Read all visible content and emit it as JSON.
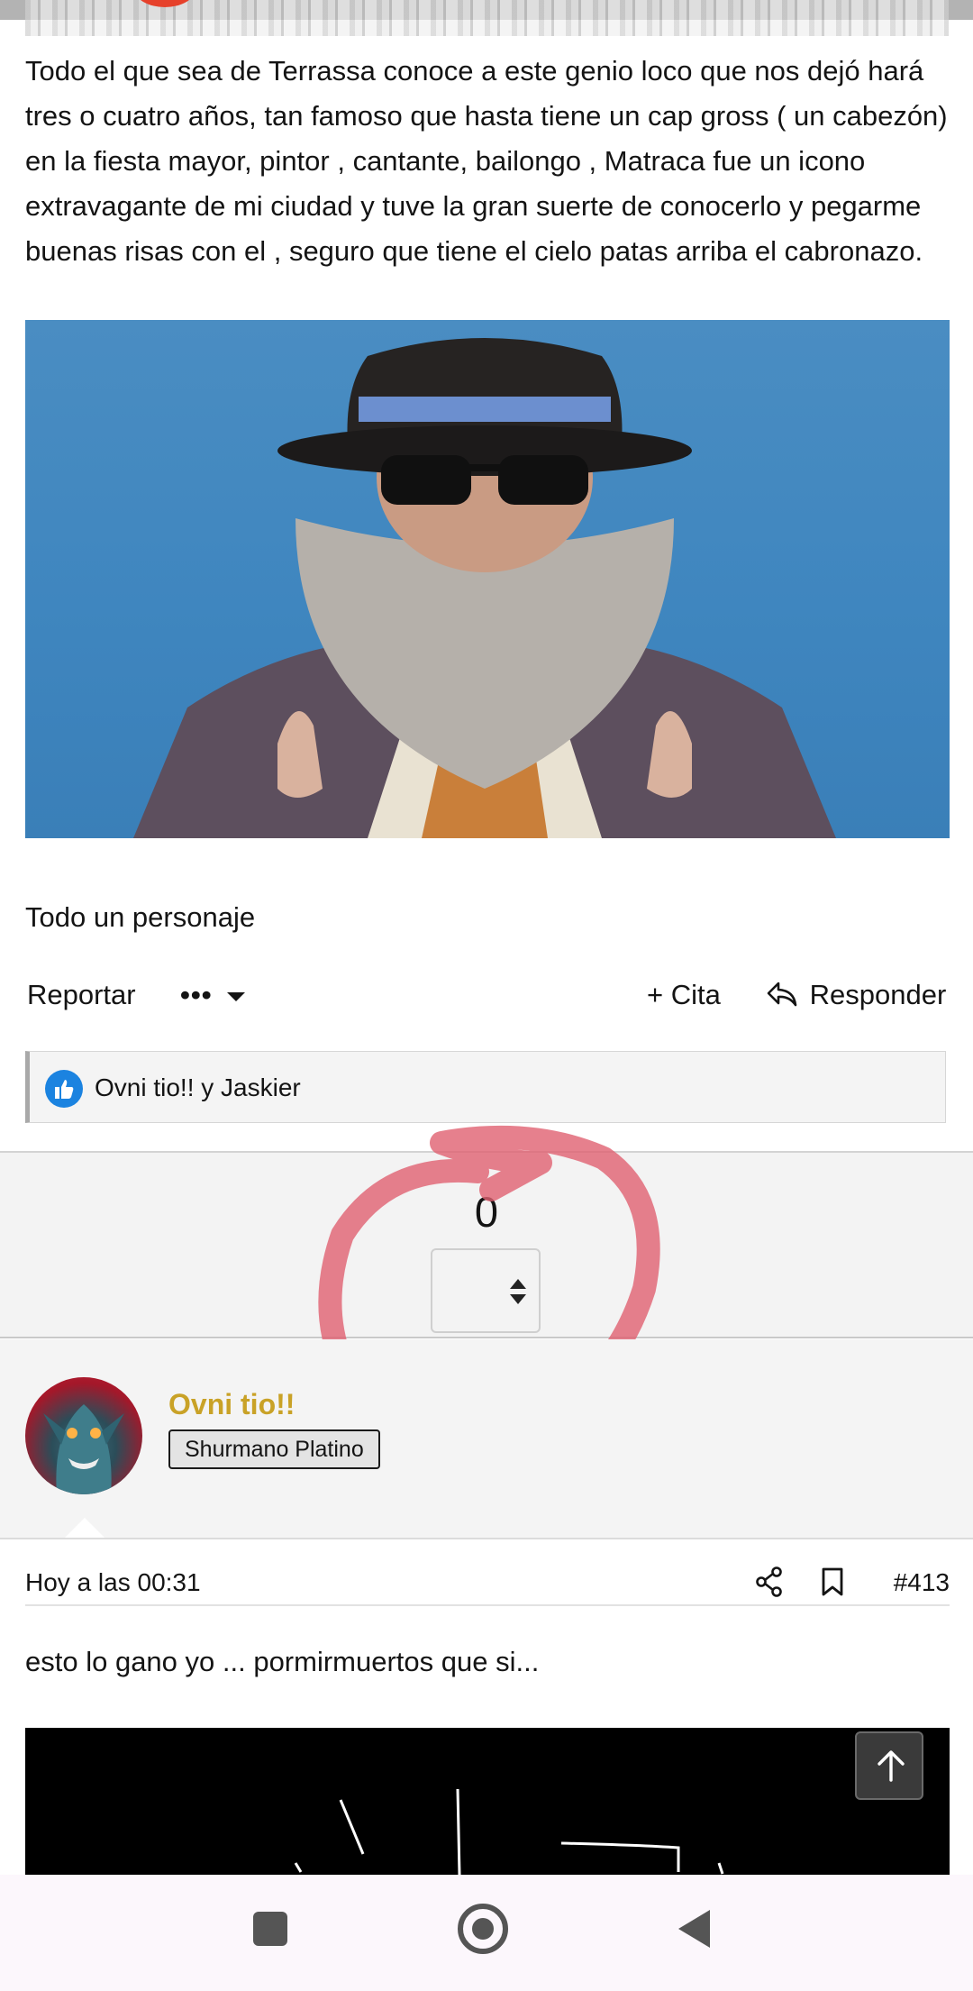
{
  "post": {
    "text": "Todo el que sea de Terrassa conoce a este genio loco que nos dejó hará tres o cuatro años, tan famoso que hasta tiene un cap gross ( un cabezón) en la fiesta mayor, pintor , cantante, bailongo , Matraca fue un icono extravagante de mi ciudad y tuve la gran suerte de conocerlo y pegarme buenas risas con el , seguro que tiene el cielo patas arriba el cabronazo.",
    "caption": "Todo un personaje",
    "actions": {
      "report": "Reportar",
      "more": "•••",
      "quote": "+ Cita",
      "reply": "Responder"
    },
    "reactions": "Ovni tio!! y Jaskier"
  },
  "vote": {
    "count": "0"
  },
  "reply_post": {
    "author": "Ovni tio!!",
    "badge": "Shurmano Platino",
    "date": "Hoy a las 00:31",
    "number": "#413",
    "text": "esto lo gano yo ... pormirmuertos que si..."
  },
  "icons": {
    "more": "chevron-down-icon",
    "quote": "plus-icon",
    "reply": "reply-arrow-icon",
    "like": "thumbs-up-icon",
    "share": "share-icon",
    "bookmark": "bookmark-icon",
    "scroll_top": "arrow-up-icon"
  },
  "colors": {
    "author_name": "#c9a227",
    "like_badge": "#1b83e0",
    "annotation_circle": "#e06070"
  }
}
